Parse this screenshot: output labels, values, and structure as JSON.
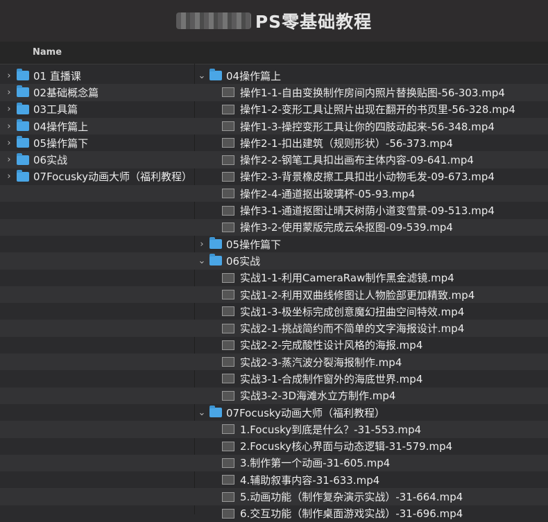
{
  "window": {
    "title": "PS零基础教程"
  },
  "header": {
    "name": "Name"
  },
  "left_items": [
    {
      "label": "01 直播课"
    },
    {
      "label": "02基础概念篇"
    },
    {
      "label": "03工具篇"
    },
    {
      "label": "04操作篇上"
    },
    {
      "label": "05操作篇下"
    },
    {
      "label": "06实战"
    },
    {
      "label": "07Focusky动画大师（福利教程）"
    }
  ],
  "right_items": [
    {
      "type": "folder",
      "expanded": true,
      "label": "04操作篇上"
    },
    {
      "type": "file",
      "label": "操作1-1-自由变换制作房间内照片替换贴图-56-303.mp4"
    },
    {
      "type": "file",
      "label": "操作1-2-变形工具让照片出现在翻开的书页里-56-328.mp4"
    },
    {
      "type": "file",
      "label": "操作1-3-操控变形工具让你的四肢动起来-56-348.mp4"
    },
    {
      "type": "file",
      "label": "操作2-1-扣出建筑（规则形状）-56-373.mp4"
    },
    {
      "type": "file",
      "label": "操作2-2-钢笔工具扣出画布主体内容-09-641.mp4"
    },
    {
      "type": "file",
      "label": "操作2-3-背景橡皮擦工具扣出小动物毛发-09-673.mp4"
    },
    {
      "type": "file",
      "label": "操作2-4-通道抠出玻璃杯-05-93.mp4"
    },
    {
      "type": "file",
      "label": "操作3-1-通道抠图让晴天树荫小道变雪景-09-513.mp4"
    },
    {
      "type": "file",
      "label": "操作3-2-使用蒙版完成云朵抠图-09-539.mp4"
    },
    {
      "type": "folder",
      "expanded": false,
      "label": "05操作篇下"
    },
    {
      "type": "folder",
      "expanded": true,
      "label": "06实战"
    },
    {
      "type": "file",
      "label": "实战1-1-利用CameraRaw制作黑金滤镜.mp4"
    },
    {
      "type": "file",
      "label": "实战1-2-利用双曲线修图让人物脸部更加精致.mp4"
    },
    {
      "type": "file",
      "label": "实战1-3-极坐标完成创意魔幻扭曲空间特效.mp4"
    },
    {
      "type": "file",
      "label": "实战2-1-挑战简约而不简单的文字海报设计.mp4"
    },
    {
      "type": "file",
      "label": "实战2-2-完成酸性设计风格的海报.mp4"
    },
    {
      "type": "file",
      "label": "实战2-3-蒸汽波分裂海报制作.mp4"
    },
    {
      "type": "file",
      "label": "实战3-1-合成制作窗外的海底世界.mp4"
    },
    {
      "type": "file",
      "label": "实战3-2-3D海滩水立方制作.mp4"
    },
    {
      "type": "folder",
      "expanded": true,
      "label": "07Focusky动画大师（福利教程）"
    },
    {
      "type": "file",
      "label": "1.Focusky到底是什么？-31-553.mp4"
    },
    {
      "type": "file",
      "label": "2.Focusky核心界面与动态逻辑-31-579.mp4"
    },
    {
      "type": "file",
      "label": "3.制作第一个动画-31-605.mp4"
    },
    {
      "type": "file",
      "label": "4.辅助叙事内容-31-633.mp4"
    },
    {
      "type": "file",
      "label": "5.动画功能（制作复杂演示实战）-31-664.mp4"
    },
    {
      "type": "file",
      "label": "6.交互功能（制作桌面游戏实战）-31-696.mp4"
    }
  ],
  "colors": {
    "folder": "#4aa6e6",
    "background": "#2b2b2d",
    "alt_row": "#333335"
  },
  "icons": {
    "chevron_right": "›",
    "chevron_down": "⌄"
  }
}
